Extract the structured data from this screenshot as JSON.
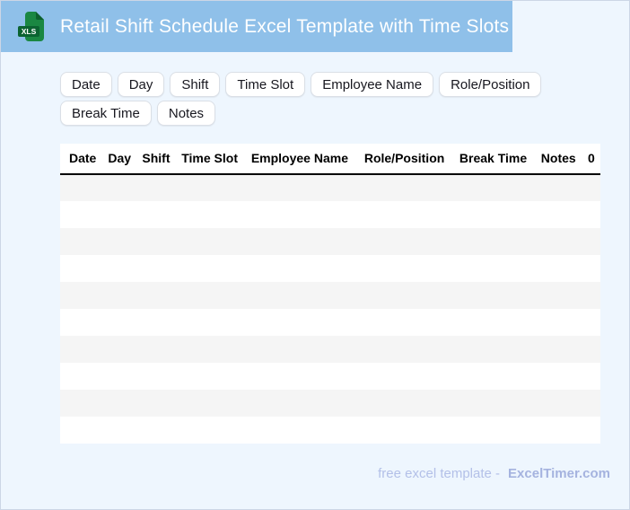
{
  "header": {
    "title": "Retail Shift Schedule Excel Template with Time Slots",
    "icon": "xls-file-icon",
    "icon_label": "XLS",
    "bg_color": "#8fc0e9",
    "icon_body_color": "#1a8742",
    "icon_fold_color": "#0d5f2d",
    "icon_banner_color": "#0b6331"
  },
  "chips": [
    "Date",
    "Day",
    "Shift",
    "Time Slot",
    "Employee Name",
    "Role/Position",
    "Break Time",
    "Notes"
  ],
  "table": {
    "columns": [
      "Date",
      "Day",
      "Shift",
      "Time Slot",
      "Employee Name",
      "Role/Position",
      "Break Time",
      "Notes",
      "0"
    ],
    "row_count": 10,
    "rows_are_empty": true,
    "stripe_colors": [
      "#f5f5f5",
      "#ffffff"
    ],
    "header_underline_color": "#000000"
  },
  "footer": {
    "text": "free excel template -",
    "brand": "ExcelTimer.com"
  },
  "colors": {
    "page_background": "#eef6fe",
    "page_border": "#ccd6e6",
    "chip_background": "#ffffff",
    "chip_border": "#dadfe6",
    "footer_text": "#b3c0e8",
    "footer_brand": "#a5b3df"
  }
}
